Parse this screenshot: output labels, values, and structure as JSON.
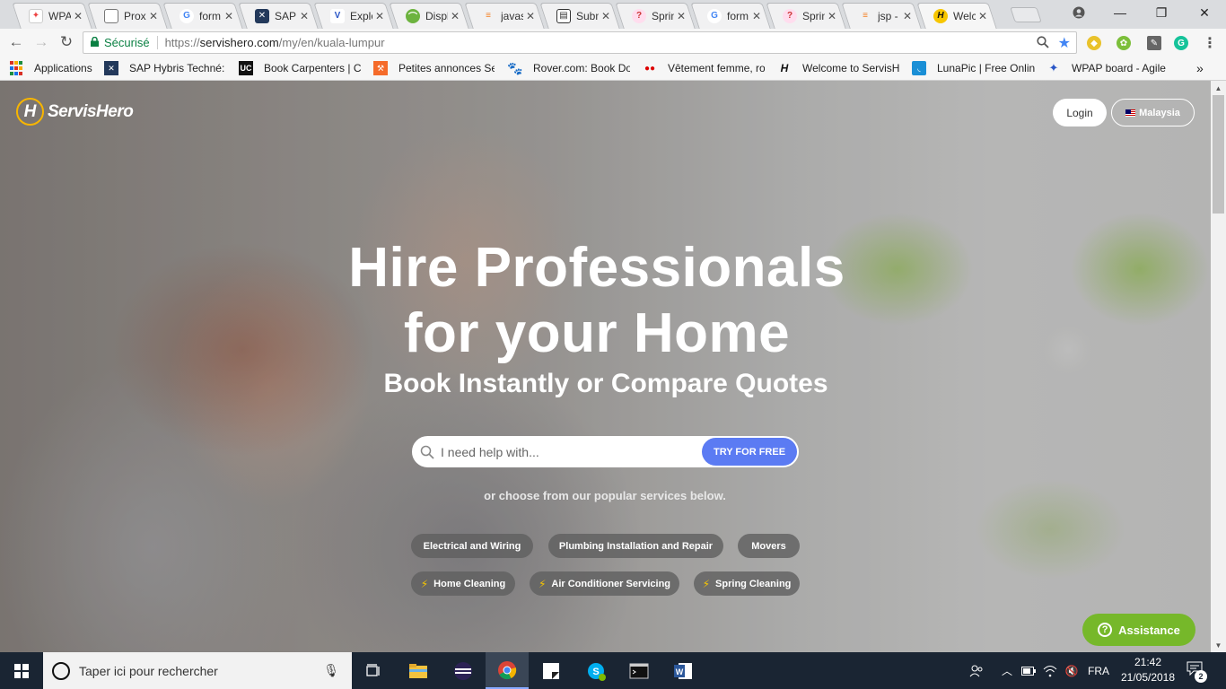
{
  "browser": {
    "tabs": [
      {
        "title": "WPAP",
        "icon": "wpap-icon",
        "active": false
      },
      {
        "title": "Proxi",
        "icon": "document-icon",
        "active": false
      },
      {
        "title": "form",
        "icon": "google-icon",
        "active": false
      },
      {
        "title": "SAP H",
        "icon": "sap-icon",
        "active": false
      },
      {
        "title": "Explo",
        "icon": "explore-icon",
        "active": false
      },
      {
        "title": "Displ",
        "icon": "leaf-icon",
        "active": false
      },
      {
        "title": "javas",
        "icon": "stackoverflow-icon",
        "active": false
      },
      {
        "title": "Subm",
        "icon": "form-icon",
        "active": false
      },
      {
        "title": "Sprin",
        "icon": "spring-icon",
        "active": false
      },
      {
        "title": "form",
        "icon": "google-icon",
        "active": false
      },
      {
        "title": "Sprin",
        "icon": "spring-icon",
        "active": false
      },
      {
        "title": "jsp -",
        "icon": "stackoverflow-icon",
        "active": false
      },
      {
        "title": "Welc",
        "icon": "servishero-icon",
        "active": true
      }
    ],
    "tab_close_glyph": "✕",
    "secure_label": "Sécurisé",
    "url_prefix": "https://",
    "url_main": "servishero.com",
    "url_path": "/my/en/kuala-lumpur",
    "bookmarks": [
      {
        "label": "Applications",
        "icon": "apps-grid-icon"
      },
      {
        "label": "SAP Hybris Techné: Y",
        "icon": "sap-icon"
      },
      {
        "label": "Book Carpenters | Ca",
        "icon": "uc-icon"
      },
      {
        "label": "Petites annonces Ser",
        "icon": "ads-icon"
      },
      {
        "label": "Rover.com: Book Do",
        "icon": "paw-icon"
      },
      {
        "label": "Vêtement femme, ro",
        "icon": "dots-icon"
      },
      {
        "label": "Welcome to ServisHe",
        "icon": "servishero-icon"
      },
      {
        "label": "LunaPic | Free Online",
        "icon": "lunapic-icon"
      },
      {
        "label": "WPAP board - Agile",
        "icon": "wpap-icon"
      }
    ],
    "bookmarks_more": "»"
  },
  "site": {
    "brand": "ServisHero",
    "brand_initial": "H",
    "login_label": "Login",
    "country_label": "Malaysia",
    "headline_line1": "Hire Professionals",
    "headline_line2": "for your Home",
    "subheadline": "Book Instantly or Compare Quotes",
    "search_placeholder": "I need help with...",
    "search_button": "TRY FOR FREE",
    "choose_text": "or choose from our popular services below.",
    "services_row1": [
      "Electrical and Wiring",
      "Plumbing Installation and Repair",
      "Movers"
    ],
    "services_row2": [
      "Home Cleaning",
      "Air Conditioner Servicing",
      "Spring Cleaning"
    ],
    "assist_label": "Assistance",
    "assist_glyph": "?",
    "colors": {
      "accent": "#5b7bf3",
      "assist": "#76b82a",
      "logo_ring": "#f7b500",
      "bolt": "#f7c600"
    }
  },
  "taskbar": {
    "search_placeholder": "Taper ici pour rechercher",
    "lang": "FRA",
    "time": "21:42",
    "date": "21/05/2018",
    "notifications": "2"
  }
}
